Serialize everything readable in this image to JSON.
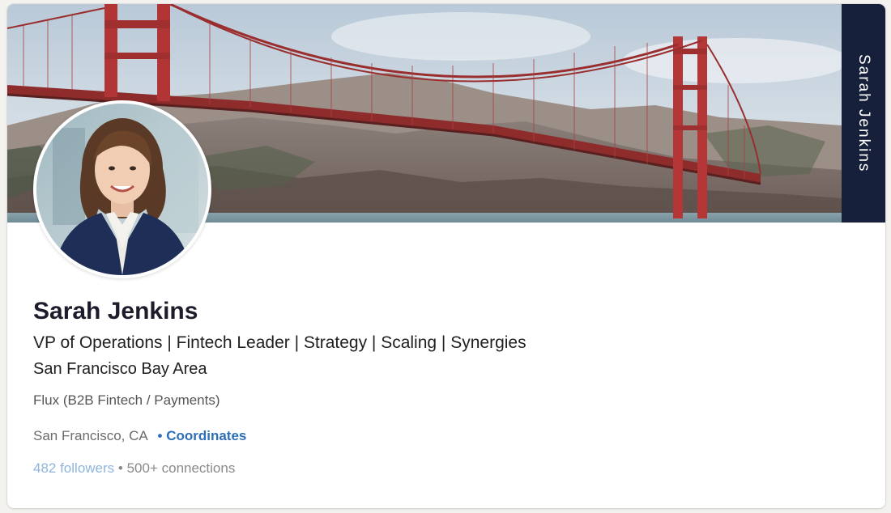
{
  "profile": {
    "name": "Sarah Jenkins",
    "side_tab_name": "Sarah Jenkins",
    "headline": "VP of Operations | Fintech Leader | Strategy | Scaling | Synergies",
    "region": "San Francisco Bay Area",
    "company": "Flux (B2B Fintech / Payments)",
    "location": "San Francisco, CA",
    "coordinates_label": "• Coordinates",
    "followers": "482 followers",
    "separator": "•",
    "connections": "500+ connections"
  },
  "colors": {
    "side_tab_bg": "#16203a",
    "link_blue": "#2d6fb8",
    "followers_blue": "#8fb4dd",
    "name_color": "#1c1c2b"
  },
  "icons": {
    "banner": "golden-gate-bridge-photo",
    "avatar": "profile-photo"
  }
}
